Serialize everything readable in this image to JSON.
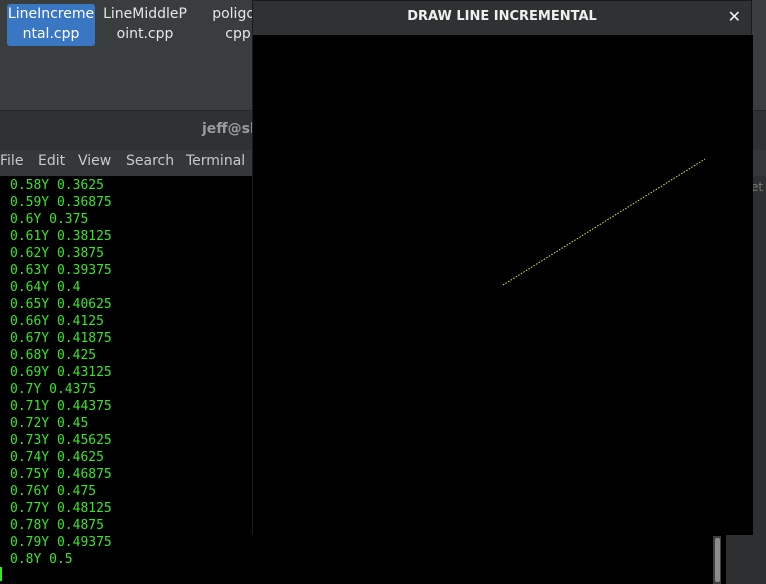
{
  "files": [
    {
      "line1": "LineIncreme",
      "line2": "ntal.cpp",
      "selected": true
    },
    {
      "line1": "LineMiddleP",
      "line2": "oint.cpp",
      "selected": false
    },
    {
      "line1": "poligon",
      "line2": "cpp",
      "selected": false
    }
  ],
  "terminal": {
    "title": "jeff@sl",
    "menu": [
      "File",
      "Edit",
      "View",
      "Search",
      "Terminal"
    ],
    "lines": [
      "0.58Y 0.3625",
      "0.59Y 0.36875",
      "0.6Y 0.375",
      "0.61Y 0.38125",
      "0.62Y 0.3875",
      "0.63Y 0.39375",
      "0.64Y 0.4",
      "0.65Y 0.40625",
      "0.66Y 0.4125",
      "0.67Y 0.41875",
      "0.68Y 0.425",
      "0.69Y 0.43125",
      "0.7Y 0.4375",
      "0.71Y 0.44375",
      "0.72Y 0.45",
      "0.73Y 0.45625",
      "0.74Y 0.4625",
      "0.75Y 0.46875",
      "0.76Y 0.475",
      "0.77Y 0.48125",
      "0.78Y 0.4875",
      "0.79Y 0.49375",
      "0.8Y 0.5"
    ],
    "right_fragment": "et"
  },
  "gl_window": {
    "title": "DRAW LINE INCREMENTAL",
    "close_icon": "close-icon",
    "line_color": "#e8e84a",
    "canvas_bg": "#000000"
  },
  "colors": {
    "terminal_text": "#39e626",
    "selected_file": "#3a77c3"
  }
}
